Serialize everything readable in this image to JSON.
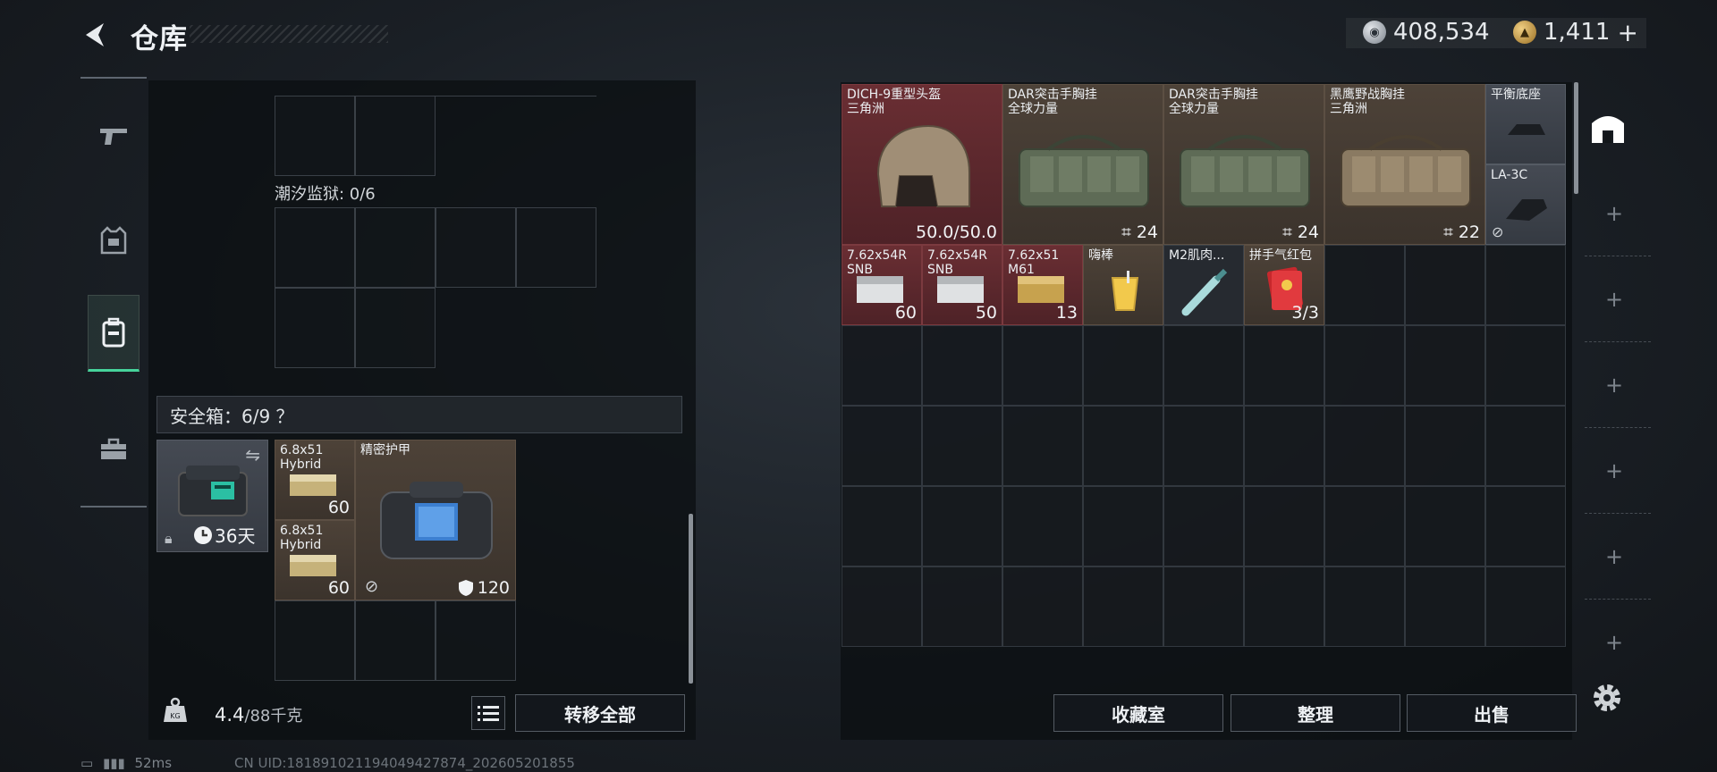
{
  "header": {
    "title": "仓库"
  },
  "currency": {
    "silver": "408,534",
    "gold": "1,411",
    "gold_add": "+"
  },
  "nav": {
    "items": [
      "weapons",
      "armor",
      "backpack",
      "toolbox"
    ],
    "active": 2
  },
  "left": {
    "prison_label": "潮汐监狱: 0/6",
    "safe_label": "安全箱：6/9 ？",
    "safebox": {
      "duration": "36天"
    },
    "items": [
      {
        "name1": "6.8x51",
        "name2": "Hybrid",
        "count": "60"
      },
      {
        "name1": "6.8x51",
        "name2": "Hybrid",
        "count": "60"
      },
      {
        "name1": "精密护甲",
        "durability": "120"
      }
    ],
    "weight_value": "4.4",
    "weight_max": "/88千克",
    "transfer_label": "转移全部"
  },
  "right": {
    "items_row1": [
      {
        "name1": "DICH-9重型头盔",
        "name2": "三角洲",
        "count": "50.0/50.0"
      },
      {
        "name1": "DAR突击手胸挂",
        "name2": "全球力量",
        "count": "24"
      },
      {
        "name1": "DAR突击手胸挂",
        "name2": "全球力量",
        "count": "24"
      },
      {
        "name1": "黑鹰野战胸挂",
        "name2": "三角洲",
        "count": "22"
      }
    ],
    "small_items": [
      {
        "name1": "平衡底座"
      },
      {
        "name1": "LA-3C"
      }
    ],
    "items_row2": [
      {
        "name1": "7.62x54R",
        "name2": "SNB",
        "count": "60"
      },
      {
        "name1": "7.62x54R",
        "name2": "SNB",
        "count": "50"
      },
      {
        "name1": "7.62x51",
        "name2": "M61",
        "count": "13"
      },
      {
        "name1": "嗨棒",
        "count": ""
      },
      {
        "name1": "M2肌肉...",
        "count": ""
      },
      {
        "name1": "拼手气红包",
        "count": "3/3"
      }
    ],
    "buttons": {
      "collection": "收藏室",
      "sort": "整理",
      "sell": "出售"
    }
  },
  "status": {
    "ping": "52ms",
    "uid": "CN UID:18189102119404942787​4_202605201855"
  },
  "colors": {
    "accent": "#46d39b",
    "red_slot": "#6a2e33",
    "brown_slot": "#4d4238"
  }
}
